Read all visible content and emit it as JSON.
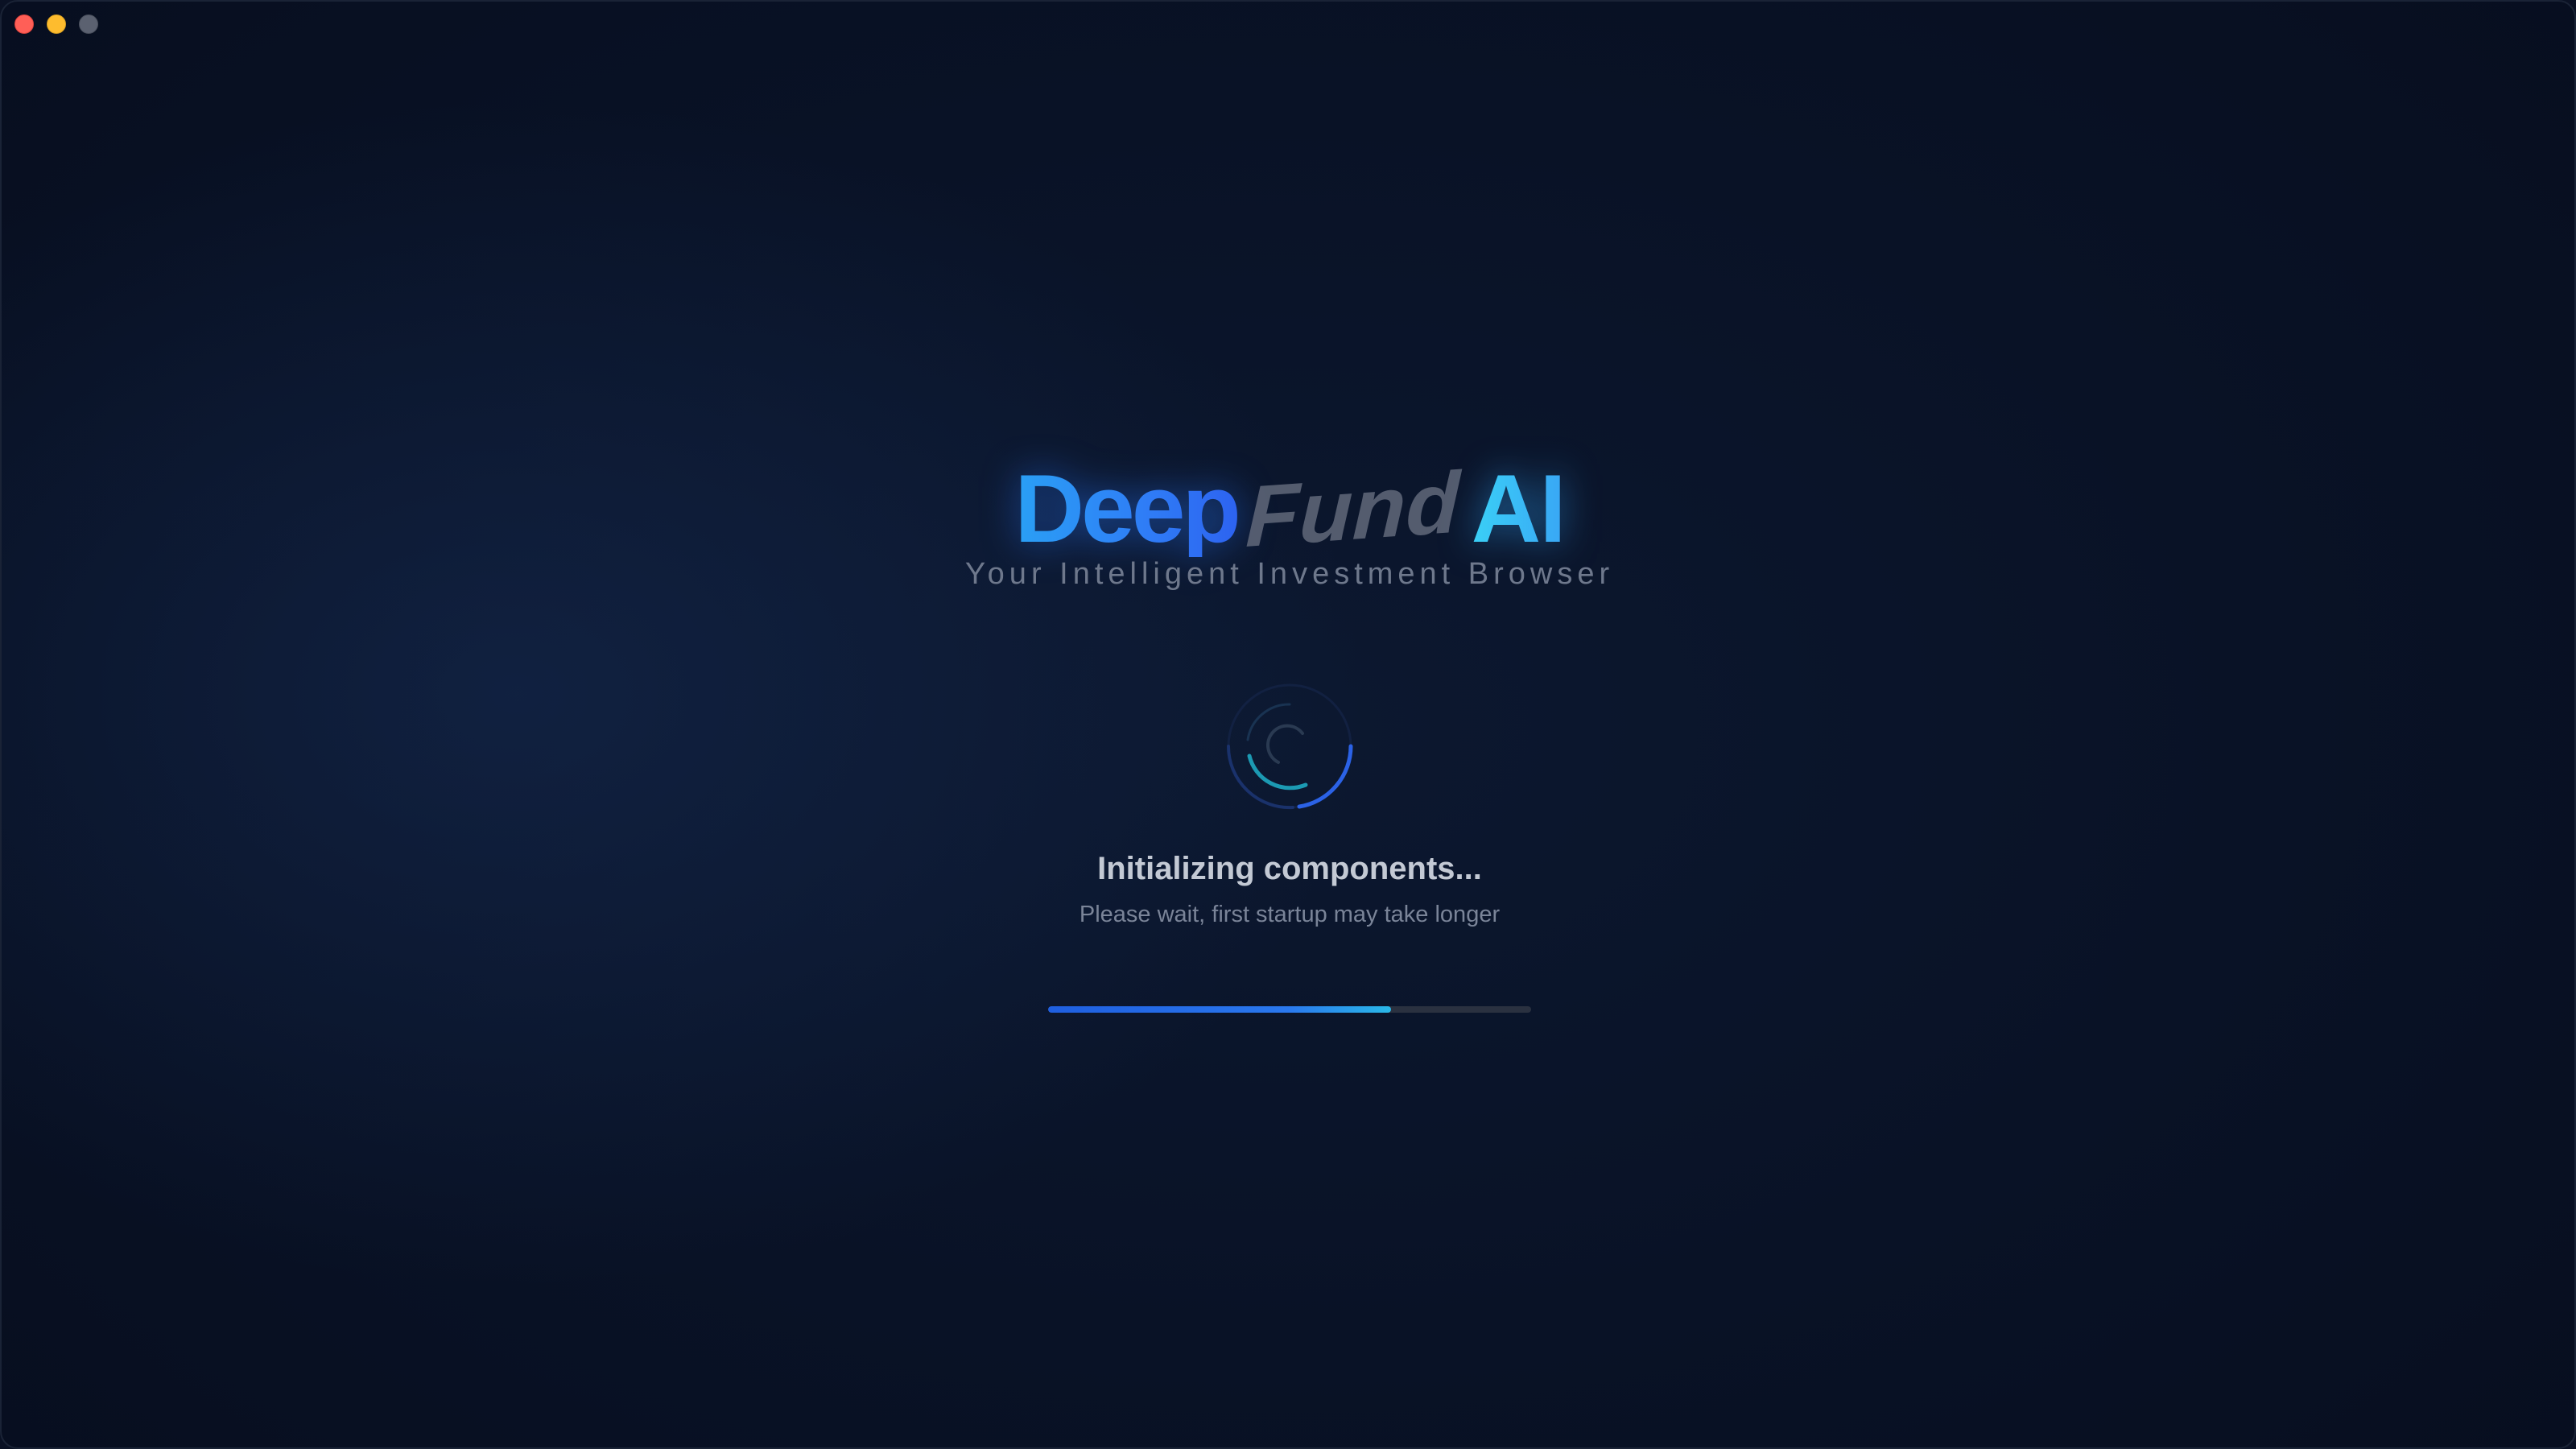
{
  "window": {
    "controls": [
      "close-button",
      "minimize-button",
      "zoom-button"
    ]
  },
  "brand": {
    "part1": "Deep",
    "part2": "Fund",
    "part3": "AI",
    "tagline": "Your Intelligent Investment Browser",
    "colors": {
      "deep": "#2e8cf5",
      "fund": "#5c6476",
      "ai": "#3cc2f5"
    }
  },
  "loading": {
    "icon": "spinner-icon",
    "status": "Initializing components...",
    "message": "Please wait, first startup may take longer",
    "progress": 0.71,
    "colors": {
      "fill": "#2a78ee",
      "track": "#2a3140"
    }
  }
}
